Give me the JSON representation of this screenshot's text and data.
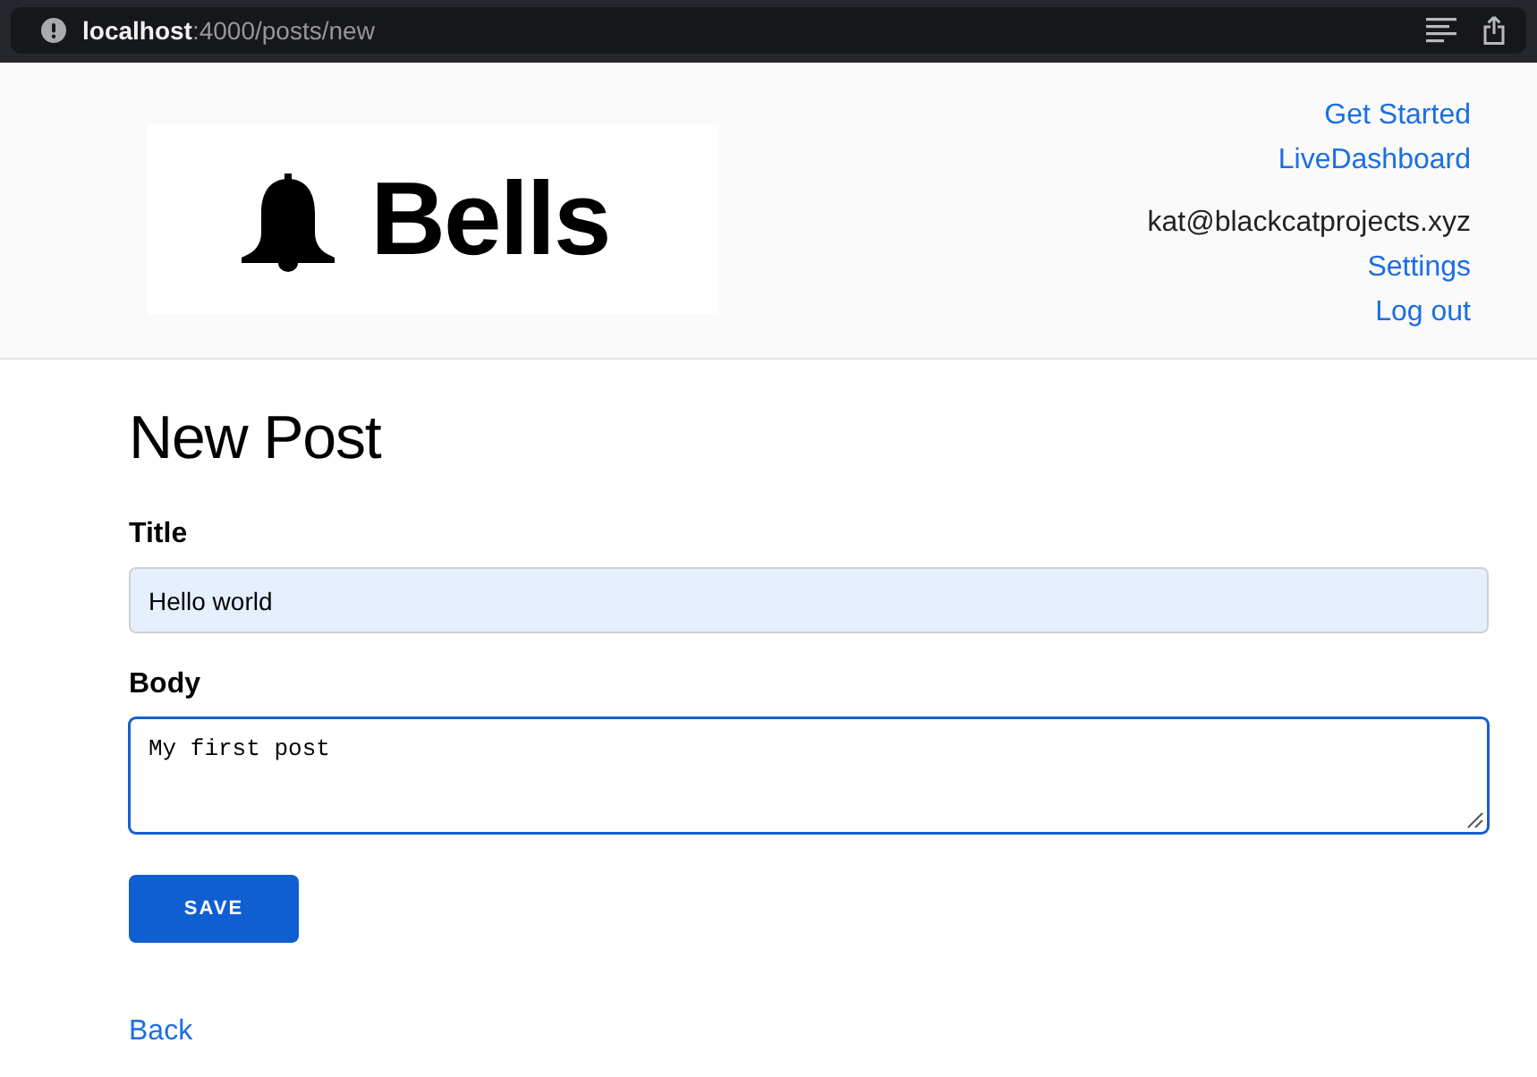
{
  "browser": {
    "url": "**localhost**:4000/posts/new"
  },
  "header": {
    "logo_text": "Bells",
    "nav_links": [
      "Get Started",
      "LiveDashboard"
    ],
    "user_email": "kat@blackcatprojects.xyz",
    "user_links": [
      "Settings",
      "Log out"
    ]
  },
  "page": {
    "title": "New Post"
  },
  "form": {
    "fields": [
      {
        "kind": "input",
        "label": "Title",
        "value": "Hello world",
        "focused": false,
        "autofilled": true
      },
      {
        "kind": "textarea",
        "label": "Body",
        "value": "My first post",
        "focused": true,
        "autofilled": false
      }
    ],
    "submit": "SAVE"
  },
  "back_link": "Back"
}
